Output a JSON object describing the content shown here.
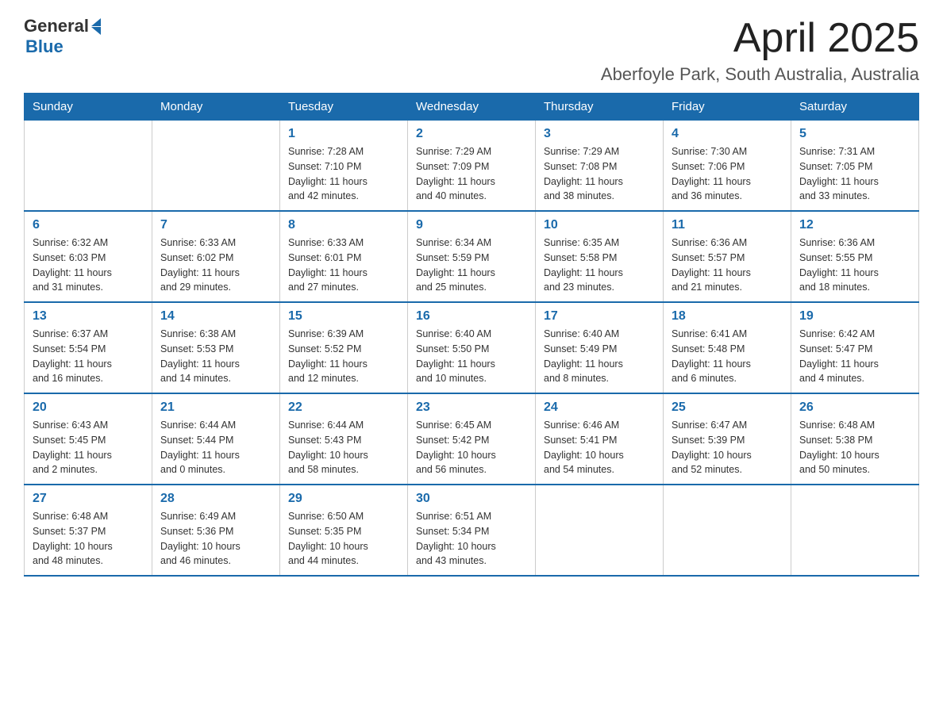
{
  "logo": {
    "general": "General",
    "blue": "Blue"
  },
  "title": "April 2025",
  "subtitle": "Aberfoyle Park, South Australia, Australia",
  "weekdays": [
    "Sunday",
    "Monday",
    "Tuesday",
    "Wednesday",
    "Thursday",
    "Friday",
    "Saturday"
  ],
  "weeks": [
    [
      {
        "day": "",
        "info": ""
      },
      {
        "day": "",
        "info": ""
      },
      {
        "day": "1",
        "info": "Sunrise: 7:28 AM\nSunset: 7:10 PM\nDaylight: 11 hours\nand 42 minutes."
      },
      {
        "day": "2",
        "info": "Sunrise: 7:29 AM\nSunset: 7:09 PM\nDaylight: 11 hours\nand 40 minutes."
      },
      {
        "day": "3",
        "info": "Sunrise: 7:29 AM\nSunset: 7:08 PM\nDaylight: 11 hours\nand 38 minutes."
      },
      {
        "day": "4",
        "info": "Sunrise: 7:30 AM\nSunset: 7:06 PM\nDaylight: 11 hours\nand 36 minutes."
      },
      {
        "day": "5",
        "info": "Sunrise: 7:31 AM\nSunset: 7:05 PM\nDaylight: 11 hours\nand 33 minutes."
      }
    ],
    [
      {
        "day": "6",
        "info": "Sunrise: 6:32 AM\nSunset: 6:03 PM\nDaylight: 11 hours\nand 31 minutes."
      },
      {
        "day": "7",
        "info": "Sunrise: 6:33 AM\nSunset: 6:02 PM\nDaylight: 11 hours\nand 29 minutes."
      },
      {
        "day": "8",
        "info": "Sunrise: 6:33 AM\nSunset: 6:01 PM\nDaylight: 11 hours\nand 27 minutes."
      },
      {
        "day": "9",
        "info": "Sunrise: 6:34 AM\nSunset: 5:59 PM\nDaylight: 11 hours\nand 25 minutes."
      },
      {
        "day": "10",
        "info": "Sunrise: 6:35 AM\nSunset: 5:58 PM\nDaylight: 11 hours\nand 23 minutes."
      },
      {
        "day": "11",
        "info": "Sunrise: 6:36 AM\nSunset: 5:57 PM\nDaylight: 11 hours\nand 21 minutes."
      },
      {
        "day": "12",
        "info": "Sunrise: 6:36 AM\nSunset: 5:55 PM\nDaylight: 11 hours\nand 18 minutes."
      }
    ],
    [
      {
        "day": "13",
        "info": "Sunrise: 6:37 AM\nSunset: 5:54 PM\nDaylight: 11 hours\nand 16 minutes."
      },
      {
        "day": "14",
        "info": "Sunrise: 6:38 AM\nSunset: 5:53 PM\nDaylight: 11 hours\nand 14 minutes."
      },
      {
        "day": "15",
        "info": "Sunrise: 6:39 AM\nSunset: 5:52 PM\nDaylight: 11 hours\nand 12 minutes."
      },
      {
        "day": "16",
        "info": "Sunrise: 6:40 AM\nSunset: 5:50 PM\nDaylight: 11 hours\nand 10 minutes."
      },
      {
        "day": "17",
        "info": "Sunrise: 6:40 AM\nSunset: 5:49 PM\nDaylight: 11 hours\nand 8 minutes."
      },
      {
        "day": "18",
        "info": "Sunrise: 6:41 AM\nSunset: 5:48 PM\nDaylight: 11 hours\nand 6 minutes."
      },
      {
        "day": "19",
        "info": "Sunrise: 6:42 AM\nSunset: 5:47 PM\nDaylight: 11 hours\nand 4 minutes."
      }
    ],
    [
      {
        "day": "20",
        "info": "Sunrise: 6:43 AM\nSunset: 5:45 PM\nDaylight: 11 hours\nand 2 minutes."
      },
      {
        "day": "21",
        "info": "Sunrise: 6:44 AM\nSunset: 5:44 PM\nDaylight: 11 hours\nand 0 minutes."
      },
      {
        "day": "22",
        "info": "Sunrise: 6:44 AM\nSunset: 5:43 PM\nDaylight: 10 hours\nand 58 minutes."
      },
      {
        "day": "23",
        "info": "Sunrise: 6:45 AM\nSunset: 5:42 PM\nDaylight: 10 hours\nand 56 minutes."
      },
      {
        "day": "24",
        "info": "Sunrise: 6:46 AM\nSunset: 5:41 PM\nDaylight: 10 hours\nand 54 minutes."
      },
      {
        "day": "25",
        "info": "Sunrise: 6:47 AM\nSunset: 5:39 PM\nDaylight: 10 hours\nand 52 minutes."
      },
      {
        "day": "26",
        "info": "Sunrise: 6:48 AM\nSunset: 5:38 PM\nDaylight: 10 hours\nand 50 minutes."
      }
    ],
    [
      {
        "day": "27",
        "info": "Sunrise: 6:48 AM\nSunset: 5:37 PM\nDaylight: 10 hours\nand 48 minutes."
      },
      {
        "day": "28",
        "info": "Sunrise: 6:49 AM\nSunset: 5:36 PM\nDaylight: 10 hours\nand 46 minutes."
      },
      {
        "day": "29",
        "info": "Sunrise: 6:50 AM\nSunset: 5:35 PM\nDaylight: 10 hours\nand 44 minutes."
      },
      {
        "day": "30",
        "info": "Sunrise: 6:51 AM\nSunset: 5:34 PM\nDaylight: 10 hours\nand 43 minutes."
      },
      {
        "day": "",
        "info": ""
      },
      {
        "day": "",
        "info": ""
      },
      {
        "day": "",
        "info": ""
      }
    ]
  ]
}
